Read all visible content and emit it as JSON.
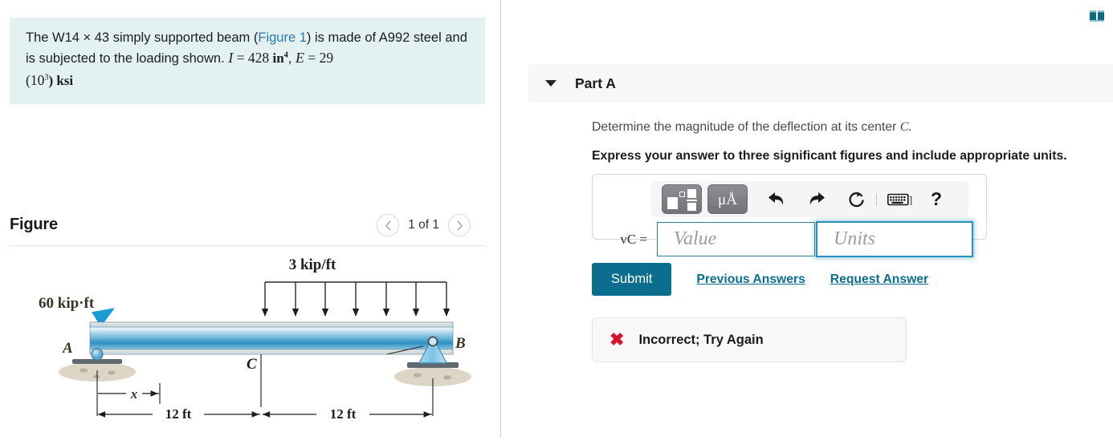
{
  "problem": {
    "line1_a": "The W14 ",
    "times": "×",
    "line1_b": " 43 simply supported beam (",
    "figure_link": "Figure 1",
    "line1_c": ") is made of A992",
    "line2_a": "steel and is subjected to the loading shown. ",
    "sym_I": "I",
    "eq1": " = 428 ",
    "unit_in": "in",
    "exp_4": "4",
    "comma": ", ",
    "sym_E": "E",
    "eq2": " = 29",
    "line3": "(10",
    "exp_3": "3",
    "line3_b": ") ksi"
  },
  "figure": {
    "title": "Figure",
    "prev_icon": "chevron-left-icon",
    "next_icon": "chevron-right-icon",
    "pager_label": "1 of 1",
    "labels": {
      "moment": "60 kip·ft",
      "distributed_load": "3 kip/ft",
      "point_a": "A",
      "point_b": "B",
      "point_c": "C",
      "dim_x": "x",
      "dim_left": "12 ft",
      "dim_right": "12 ft"
    },
    "colors": {
      "beam_top": "#cfe6f2",
      "beam_mid": "#1f7fb5",
      "arrow_blue": "#1a9ad6",
      "label_brown": "#5a4a2a",
      "ground": "#d9d2c4"
    }
  },
  "right": {
    "resources_icon": "book-icon",
    "part": {
      "caret_icon": "caret-down-icon",
      "title": "Part A",
      "question": "Determine the magnitude of the deflection at its center ",
      "question_symbol": "C.",
      "instruction": "Express your answer to three significant figures and include appropriate units."
    },
    "toolbar": {
      "template_icon": "math-template-icon",
      "units_icon": "micro-angstrom-icon",
      "undo_icon": "undo-icon",
      "redo_icon": "redo-icon",
      "reset_icon": "reset-icon",
      "keyboard_icon": "keyboard-icon",
      "help_icon": "help-icon",
      "help_label": "?"
    },
    "answer": {
      "variable_label": "vC =",
      "value_placeholder": "Value",
      "value": "",
      "units_placeholder": "Units",
      "units": ""
    },
    "actions": {
      "submit_label": "Submit",
      "previous_answers_label": "Previous Answers",
      "request_answer_label": "Request Answer"
    },
    "feedback": {
      "icon": "x-mark-icon",
      "icon_glyph": "✖",
      "text": "Incorrect; Try Again",
      "color": "#d81028"
    }
  }
}
